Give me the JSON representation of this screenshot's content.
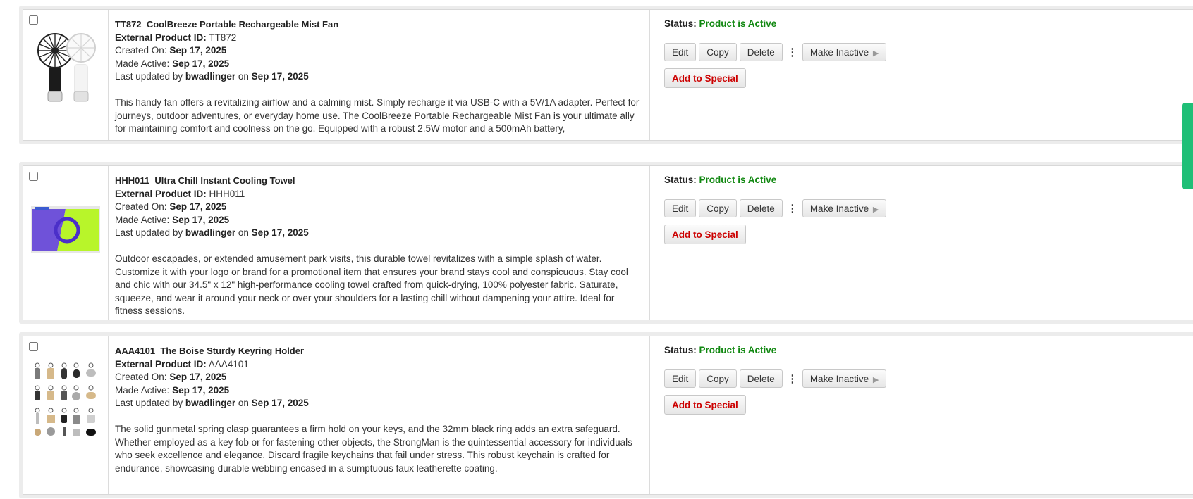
{
  "products": [
    {
      "sku": "TT872",
      "name": "CoolBreeze Portable Rechargeable Mist Fan",
      "external_id_label": "External Product ID:",
      "external_id": "TT872",
      "created_label": "Created On:",
      "created": "Sep 17, 2025",
      "made_active_label": "Made Active:",
      "made_active": "Sep 17, 2025",
      "updated_prefix": "Last updated by",
      "updated_by": "bwadlinger",
      "updated_on_word": "on",
      "updated_on": "Sep 17, 2025",
      "description": "This handy fan offers a revitalizing airflow and a calming mist. Simply recharge it via USB-C with a 5V/1A adapter. Perfect for journeys, outdoor adventures, or everyday home use. The CoolBreeze Portable Rechargeable Mist Fan is your ultimate ally for maintaining comfort and coolness on the go. Equipped with a robust 2.5W motor and a 500mAh battery,",
      "status_label": "Status:",
      "status": "Product is Active",
      "thumbnail_icon": "mist-fan-image"
    },
    {
      "sku": "HHH011",
      "name": "Ultra Chill Instant Cooling Towel",
      "external_id_label": "External Product ID:",
      "external_id": "HHH011",
      "created_label": "Created On:",
      "created": "Sep 17, 2025",
      "made_active_label": "Made Active:",
      "made_active": "Sep 17, 2025",
      "updated_prefix": "Last updated by",
      "updated_by": "bwadlinger",
      "updated_on_word": "on",
      "updated_on": "Sep 17, 2025",
      "description": "Outdoor escapades, or extended amusement park visits, this durable towel revitalizes with a simple splash of water. Customize it with your logo or brand for a promotional item that ensures your brand stays cool and conspicuous. Stay cool and chic with our 34.5\" x 12\" high-performance cooling towel crafted from quick-drying, 100% polyester fabric. Saturate, squeeze, and wear it around your neck or over your shoulders for a lasting chill without dampening your attire. Ideal for fitness sessions.",
      "status_label": "Status:",
      "status": "Product is Active",
      "thumbnail_icon": "cooling-towel-image"
    },
    {
      "sku": "AAA4101",
      "name": "The Boise Sturdy Keyring Holder",
      "external_id_label": "External Product ID:",
      "external_id": "AAA4101",
      "created_label": "Created On:",
      "created": "Sep 17, 2025",
      "made_active_label": "Made Active:",
      "made_active": "Sep 17, 2025",
      "updated_prefix": "Last updated by",
      "updated_by": "bwadlinger",
      "updated_on_word": "on",
      "updated_on": "Sep 17, 2025",
      "description": "The solid gunmetal spring clasp guarantees a firm hold on your keys, and the 32mm black ring adds an extra safeguard. Whether employed as a key fob or for fastening other objects, the StrongMan is the quintessential accessory for individuals who seek excellence and elegance. Discard fragile keychains that fail under stress. This robust keychain is crafted for endurance, showcasing durable webbing encased in a sumptuous faux leatherette coating.",
      "status_label": "Status:",
      "status": "Product is Active",
      "thumbnail_icon": "keyring-holders-image"
    }
  ],
  "actions": {
    "edit": "Edit",
    "copy": "Copy",
    "delete": "Delete",
    "more": "⋮",
    "make_inactive": "Make Inactive",
    "make_inactive_arrow": "▶",
    "add_to_special": "Add to Special"
  },
  "colors": {
    "status_active": "#118811",
    "add_to_special": "#cc0000",
    "side_tab": "#1fbf77"
  }
}
